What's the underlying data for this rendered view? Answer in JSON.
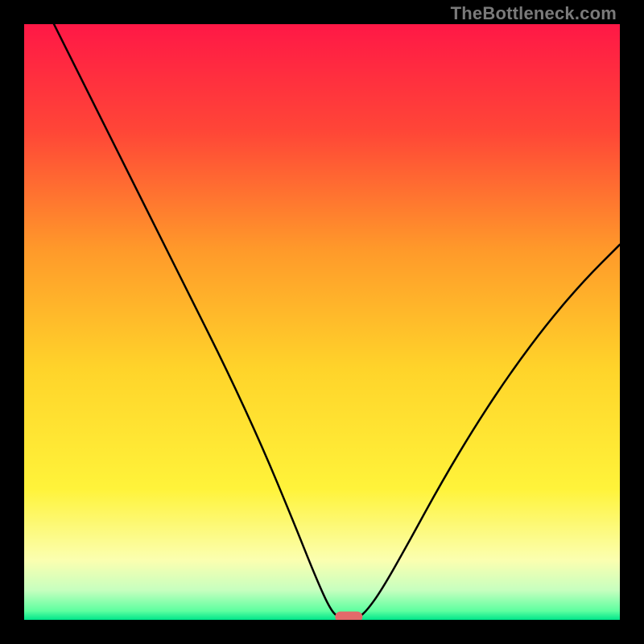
{
  "watermark": "TheBottleneck.com",
  "chart_data": {
    "type": "line",
    "title": "",
    "xlabel": "",
    "ylabel": "",
    "xlim": [
      0,
      100
    ],
    "ylim": [
      0,
      100
    ],
    "grid": false,
    "legend": false,
    "background_gradient": {
      "stops": [
        {
          "offset": 0.0,
          "color": "#ff1846"
        },
        {
          "offset": 0.18,
          "color": "#ff4637"
        },
        {
          "offset": 0.38,
          "color": "#ff9a2a"
        },
        {
          "offset": 0.58,
          "color": "#ffd42a"
        },
        {
          "offset": 0.78,
          "color": "#fff33a"
        },
        {
          "offset": 0.9,
          "color": "#fbffb0"
        },
        {
          "offset": 0.95,
          "color": "#c7ffbf"
        },
        {
          "offset": 0.985,
          "color": "#5effa0"
        },
        {
          "offset": 1.0,
          "color": "#00e58a"
        }
      ]
    },
    "series": [
      {
        "name": "bottleneck-curve",
        "color": "#000000",
        "stroke_width": 2.5,
        "points": [
          {
            "x": 5,
            "y": 100
          },
          {
            "x": 10,
            "y": 90
          },
          {
            "x": 16,
            "y": 78
          },
          {
            "x": 22,
            "y": 66
          },
          {
            "x": 28,
            "y": 54
          },
          {
            "x": 34,
            "y": 42
          },
          {
            "x": 40,
            "y": 29
          },
          {
            "x": 45,
            "y": 17
          },
          {
            "x": 49,
            "y": 7
          },
          {
            "x": 51.5,
            "y": 1.5
          },
          {
            "x": 53,
            "y": 0.3
          },
          {
            "x": 56,
            "y": 0.3
          },
          {
            "x": 57.5,
            "y": 1.5
          },
          {
            "x": 60,
            "y": 5
          },
          {
            "x": 64,
            "y": 12
          },
          {
            "x": 70,
            "y": 23
          },
          {
            "x": 76,
            "y": 33
          },
          {
            "x": 82,
            "y": 42
          },
          {
            "x": 88,
            "y": 50
          },
          {
            "x": 94,
            "y": 57
          },
          {
            "x": 100,
            "y": 63
          }
        ]
      }
    ],
    "marker": {
      "name": "optimal-point",
      "x": 54.5,
      "y": 0.5,
      "width": 4.6,
      "height": 1.8,
      "color": "#e36a6a",
      "shape": "pill"
    }
  }
}
